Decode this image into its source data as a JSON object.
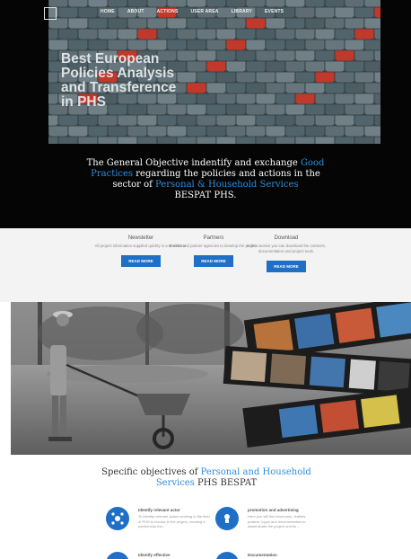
{
  "nav": {
    "logo_text": "",
    "items": [
      "HOME",
      "ABOUT",
      "ACTIONS",
      "USER AREA",
      "LIBRARY",
      "EVENTS"
    ]
  },
  "hero": {
    "title_lines": [
      "Best European",
      "Policies Analysis",
      "and Transference",
      "in PHS"
    ]
  },
  "tagline": {
    "part1": "The General Objective indentify and exchange ",
    "highlight1": "Good Practices",
    "part2": " regarding the policies and actions in the sector of ",
    "highlight2": "Personal & Household Services",
    "part3": "BESPAT PHS."
  },
  "columns": [
    {
      "title": "Newsletter",
      "text": "All project information supplied quickly in a newsletter.",
      "button": "READ MORE"
    },
    {
      "title": "Partners",
      "text": "Entities and partner agencies to develop the project.",
      "button": "READ MORE"
    },
    {
      "title": "Download",
      "text": "In this section you can download the contents, documentation and project tools.",
      "button": "READ MORE"
    }
  ],
  "objectives": {
    "title_part1": "Specific objectives of ",
    "title_highlight": "Personal and Household Services",
    "title_part2": " PHS BESPAT",
    "features": [
      {
        "title": "Identify relevant actor",
        "text": "To identify relevant actors working in the field of PHS to involve in the project, creating a partnership tha..."
      },
      {
        "title": "promotion and advertising",
        "text": "Here you will find brochures, leaflets, posters, logos and documentation to disseminate the project and its ..."
      },
      {
        "title": "Identify effective",
        "text": ""
      },
      {
        "title": "Documentation",
        "text": ""
      }
    ]
  },
  "colors": {
    "accent": "#2e8ee0",
    "button": "#1f6fc7",
    "top_background": "#050505",
    "tile_red": "#c0392b"
  }
}
